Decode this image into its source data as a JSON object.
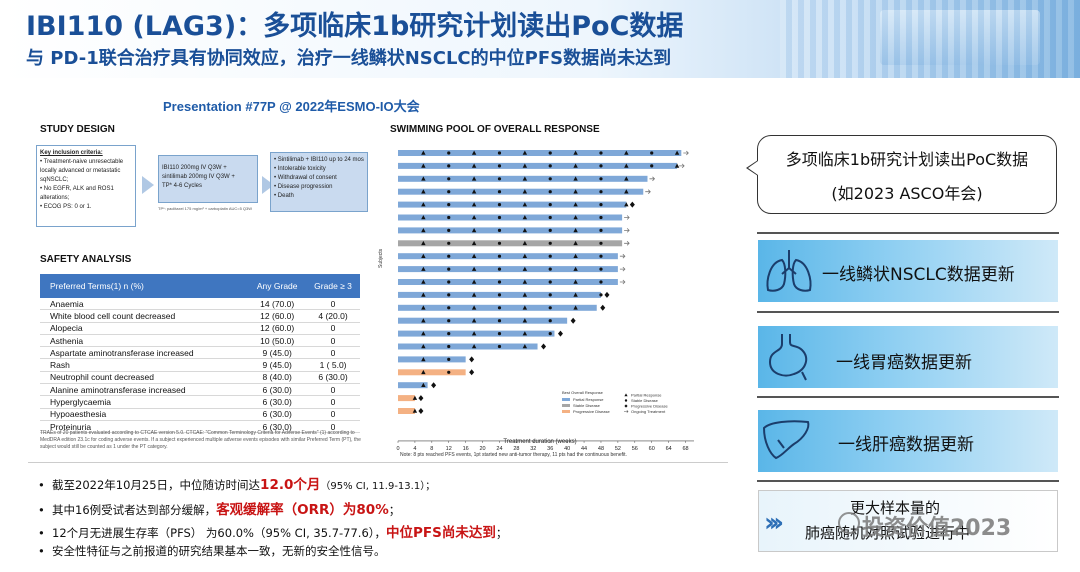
{
  "header": {
    "title": "IBI110 (LAG3)：多项临床1b研究计划读出PoC数据",
    "subtitle": "与 PD-1联合治疗具有协同效应，治疗一线鳞状NSCLC的中位PFS数据尚未达到"
  },
  "presentation": "Presentation #77P @ 2022年ESMO-IO大会",
  "study_design": {
    "title": "STUDY DESIGN",
    "inclusion_title": "Key inclusion criteria:",
    "inclusion_items": [
      "• Treatment-naive unresectable",
      "  locally advanced or metastatic",
      "  sqNSCLC;",
      "• No EGFR, ALK and ROS1",
      "  alterations;",
      "• ECOG PS: 0 or 1."
    ],
    "regimen_lines": [
      "IBI110 200mg IV Q3W +",
      "sintilimab 200mg IV Q3W +",
      "TP* 4-6 Cycles"
    ],
    "regimen_note": "TP*: paclitaxel 175 mg/m² + carboplatin AUC=5 Q3W",
    "outcome_items": [
      "• Sintilimab + IBI110 up to 24 mos",
      "• Intolerable toxicity",
      "• Withdrawal of consent",
      "• Disease progression",
      "• Death"
    ]
  },
  "safety": {
    "title": "SAFETY ANALYSIS",
    "headers": [
      "Preferred Terms(1) n (%)",
      "Any Grade",
      "Grade ≥ 3"
    ],
    "rows": [
      [
        "Anaemia",
        "14 (70.0)",
        "0"
      ],
      [
        "White blood cell count decreased",
        "12 (60.0)",
        "4 (20.0)"
      ],
      [
        "Alopecia",
        "12 (60.0)",
        "0"
      ],
      [
        "Asthenia",
        "10 (50.0)",
        "0"
      ],
      [
        "Aspartate aminotransferase increased",
        "9 (45.0)",
        "0"
      ],
      [
        "Rash",
        "9 (45.0)",
        "1 ( 5.0)"
      ],
      [
        "Neutrophil count decreased",
        "8 (40.0)",
        "6 (30.0)"
      ],
      [
        "Alanine aminotransferase increased",
        "6 (30.0)",
        "0"
      ],
      [
        "Hyperglycaemia",
        "6 (30.0)",
        "0"
      ],
      [
        "Hypoaesthesia",
        "6 (30.0)",
        "0"
      ],
      [
        "Proteinuria",
        "6 (30.0)",
        "0"
      ]
    ],
    "footnote": "TRAEs of 20 patients evaluated according to CTCAE version 5.0. CTCAE: \"Common Terminology Criteria for Adverse Events\" (1) according to MedDRA edition 23.1c for coding adverse events. If a subject experienced multiple adverse events episodes with similar Preferred Term (PT), the subject would still be counted as 1 under the PT category."
  },
  "swimming": {
    "title": "SWIMMING POOL OF OVERALL RESPONSE",
    "ylabel": "Subjects",
    "xlabel": "Treatment duration (weeks)",
    "note": "Note: 8 pts reached PFS events, 1pt started new anti-tumor therapy, 11 pts had the continuous benefit.",
    "legend_title": "Best Overall Response",
    "legend_bars": [
      "Partial Response",
      "Stable Disease",
      "Progressive Disease"
    ],
    "legend_markers": [
      "Partial Response",
      "Stable Disease",
      "Progressive Disease",
      "Ongoing Treatment"
    ]
  },
  "chart_data": {
    "type": "bar",
    "title": "SWIMMING POOL OF OVERALL RESPONSE",
    "xlabel": "Treatment duration (weeks)",
    "ylabel": "Subjects",
    "xlim": [
      0,
      70
    ],
    "xticks": [
      0,
      4,
      8,
      12,
      16,
      20,
      24,
      28,
      32,
      36,
      40,
      44,
      48,
      52,
      56,
      60,
      64,
      68
    ],
    "subjects": [
      {
        "duration": 67,
        "response": "Partial Response",
        "ongoing": true
      },
      {
        "duration": 66,
        "response": "Partial Response",
        "ongoing": true
      },
      {
        "duration": 59,
        "response": "Partial Response",
        "ongoing": true
      },
      {
        "duration": 58,
        "response": "Partial Response",
        "ongoing": true
      },
      {
        "duration": 54,
        "response": "Partial Response",
        "ongoing": false
      },
      {
        "duration": 53,
        "response": "Partial Response",
        "ongoing": true
      },
      {
        "duration": 53,
        "response": "Partial Response",
        "ongoing": true
      },
      {
        "duration": 53,
        "response": "Stable Disease",
        "ongoing": true
      },
      {
        "duration": 52,
        "response": "Partial Response",
        "ongoing": true
      },
      {
        "duration": 52,
        "response": "Partial Response",
        "ongoing": true
      },
      {
        "duration": 52,
        "response": "Partial Response",
        "ongoing": true
      },
      {
        "duration": 48,
        "response": "Partial Response",
        "ongoing": false
      },
      {
        "duration": 47,
        "response": "Partial Response",
        "ongoing": false
      },
      {
        "duration": 40,
        "response": "Partial Response",
        "ongoing": false
      },
      {
        "duration": 37,
        "response": "Partial Response",
        "ongoing": false
      },
      {
        "duration": 33,
        "response": "Partial Response",
        "ongoing": false
      },
      {
        "duration": 16,
        "response": "Partial Response",
        "ongoing": false
      },
      {
        "duration": 16,
        "response": "Progressive Disease",
        "ongoing": false
      },
      {
        "duration": 7,
        "response": "Partial Response",
        "ongoing": false
      },
      {
        "duration": 4,
        "response": "Progressive Disease",
        "ongoing": false
      },
      {
        "duration": 4,
        "response": "Progressive Disease",
        "ongoing": false
      }
    ]
  },
  "right_panel": {
    "bubble_line1": "多项临床1b研究计划读出PoC数据",
    "bubble_line2": "(如2023 ASCO年会)",
    "items": [
      "一线鳞状NSCLC数据更新",
      "一线胃癌数据更新",
      "一线肝癌数据更新"
    ],
    "last_line1": "更大样本量的",
    "last_line2": "肺癌随机对照试验进行中",
    "watermark": "投资价值2023"
  },
  "bullets": {
    "b1_pre": "截至2022年10月25日，中位随访时间达",
    "b1_red": "12.0个月",
    "b1_post": "（95% CI, 11.9-13.1）；",
    "b2_pre": "其中16例受试者达到部分缓解，",
    "b2_red": "客观缓解率（ORR）为80%",
    "b2_post": "；",
    "b3_pre": "12个月无进展生存率（PFS） 为60.0%（95% CI, 35.7-77.6），",
    "b3_red": "中位PFS尚未达到",
    "b3_post": "；",
    "b4": "安全性特征与之前报道的研究结果基本一致，无新的安全性信号。"
  },
  "colors": {
    "title_blue": "#1a4f97",
    "table_header": "#3f76c0",
    "partial_response": "#7fa8d8",
    "stable_disease": "#a6a6a6",
    "progressive_disease": "#f4b183",
    "highlight_red": "#c81414"
  }
}
